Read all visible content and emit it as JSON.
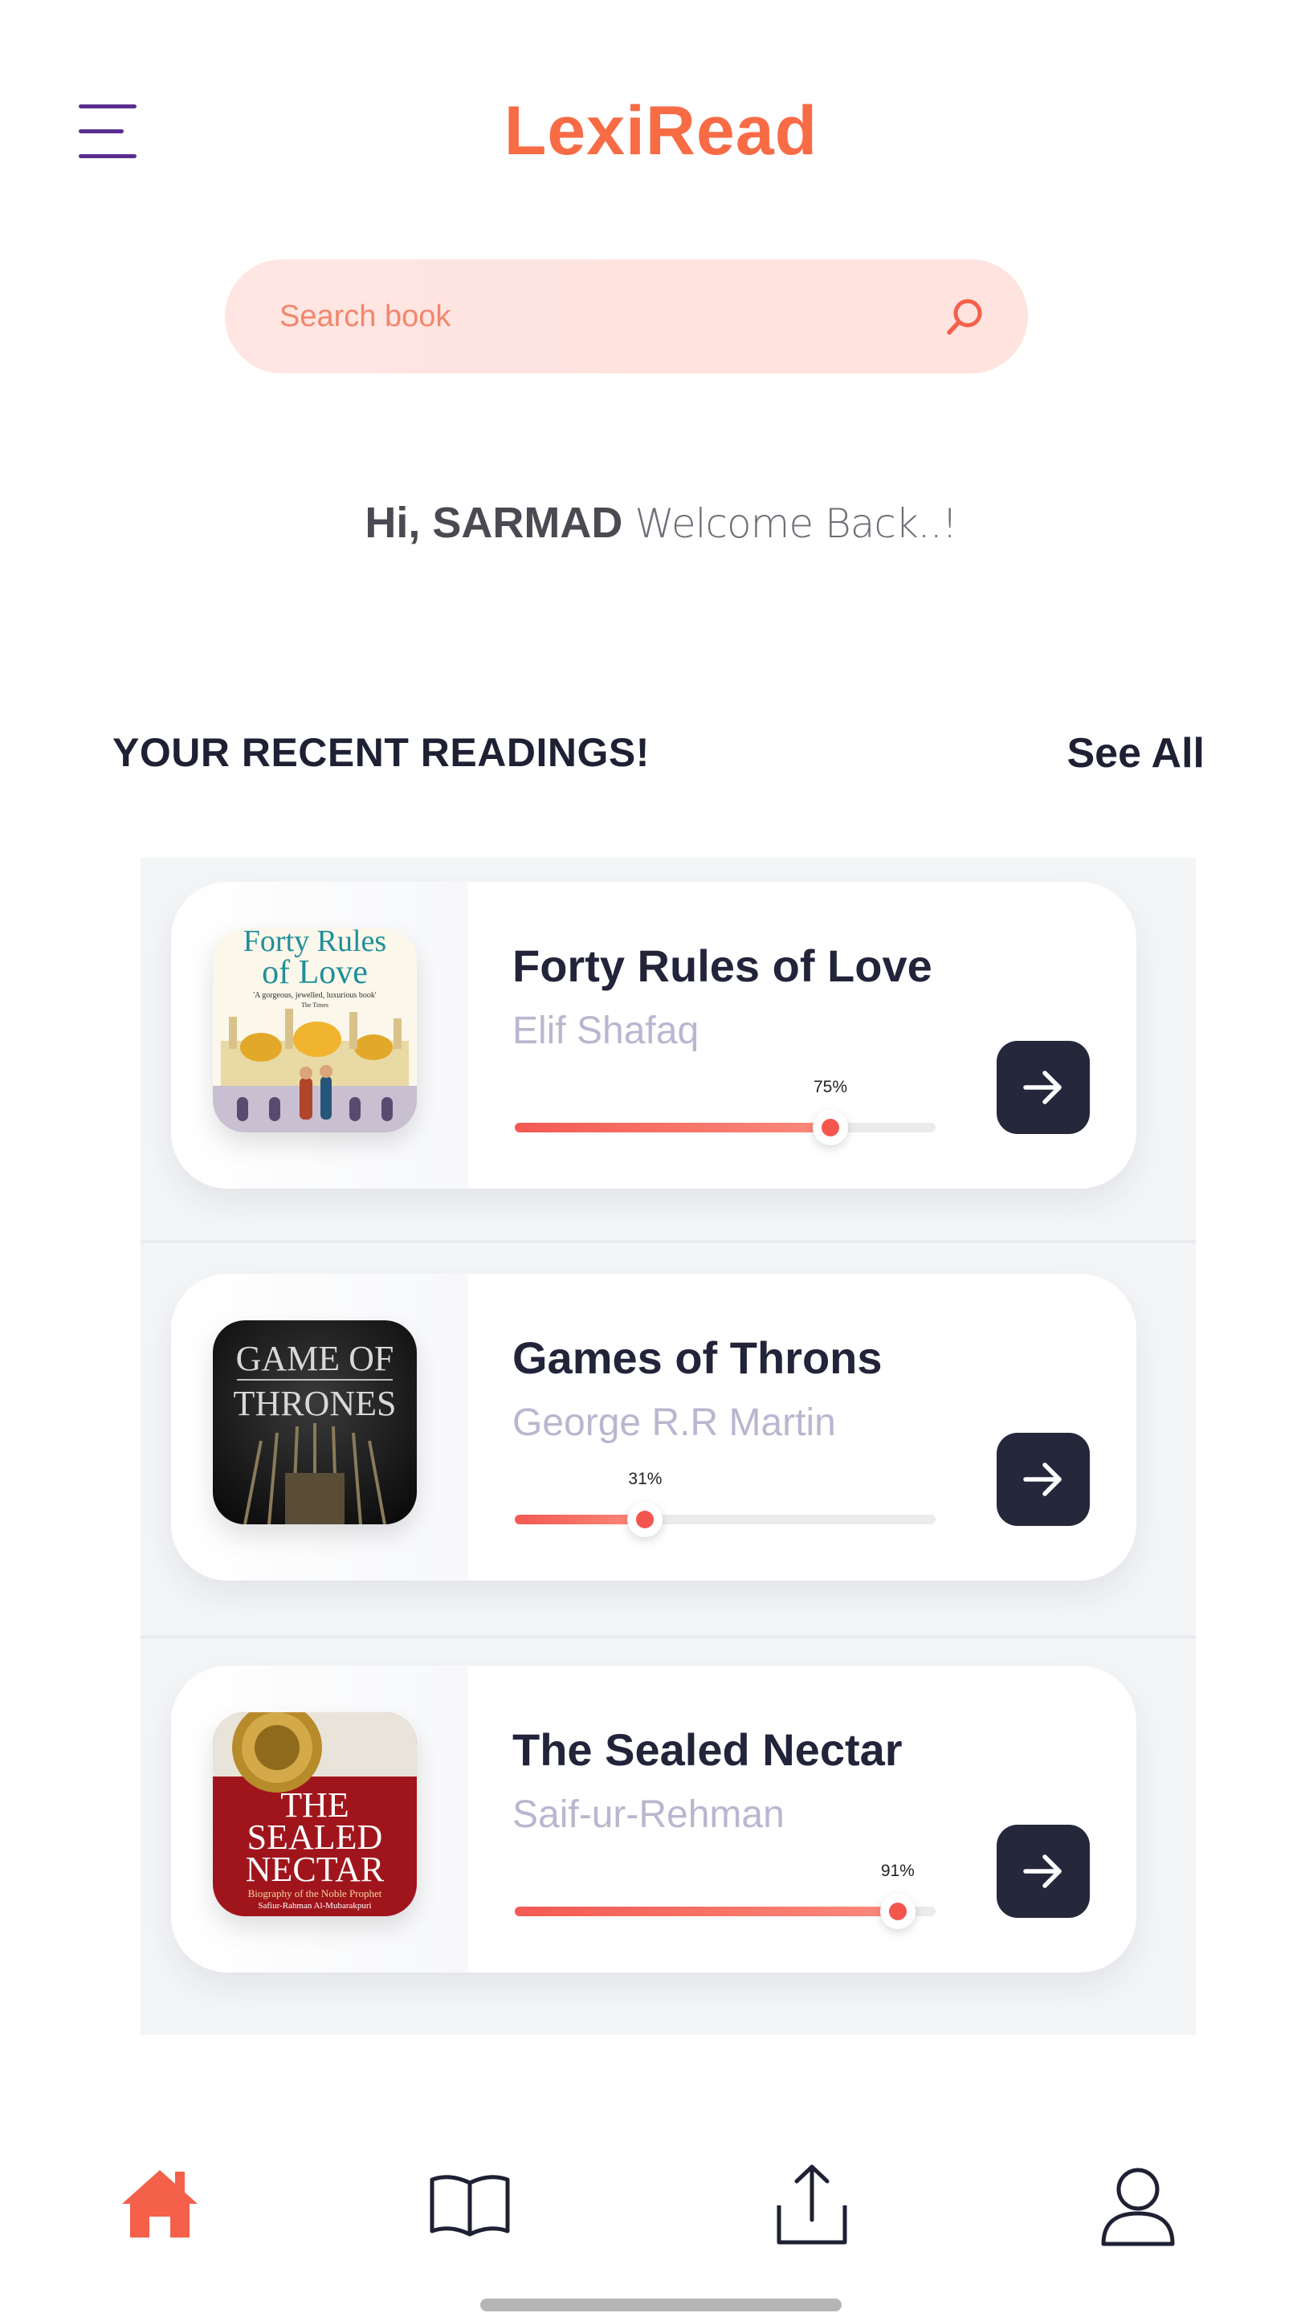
{
  "header": {
    "title": "LexiRead",
    "menu_icon": "hamburger-menu-icon"
  },
  "search": {
    "placeholder": "Search book",
    "icon": "search-icon"
  },
  "welcome": {
    "name": "Hi, SARMAD",
    "message": "Welcome Back..!"
  },
  "recent": {
    "title": "YOUR RECENT READINGS!",
    "see_all": "See All",
    "books": [
      {
        "title": "Forty Rules of Love",
        "author": "Elif Shafaq",
        "progress": 75,
        "progress_label": "75%",
        "cover_lines": [
          "Forty Rules",
          "of Love"
        ],
        "cover_tagline": "'A gorgeous, jewelled, luxurious book'",
        "cover_source": "The Times"
      },
      {
        "title": "Games of Throns",
        "author": "George R.R Martin",
        "progress": 31,
        "progress_label": "31%",
        "cover_lines": [
          "GAME OF",
          "THRONES"
        ]
      },
      {
        "title": "The Sealed Nectar",
        "author": "Saif-ur-Rehman",
        "progress": 91,
        "progress_label": "91%",
        "cover_lines": [
          "THE",
          "SEALED",
          "NECTAR"
        ],
        "cover_subtitle": "Biography of the Noble Prophet",
        "cover_author": "Safiur-Rahman Al-Mubarakpuri"
      }
    ]
  },
  "bottom_nav": {
    "items": [
      "home-icon",
      "book-icon",
      "share-icon",
      "profile-icon"
    ],
    "active": "home-icon"
  },
  "colors": {
    "brand": "#f76b45",
    "accent_purple": "#5a2d8f",
    "dark_button": "#25283a",
    "progress": "#f4564e",
    "search_bg": "#ffe4e0"
  }
}
